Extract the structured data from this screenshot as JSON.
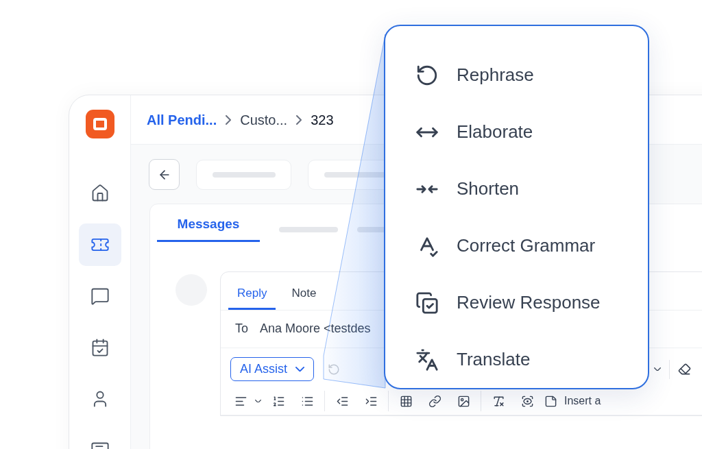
{
  "sidebar": {
    "items": [
      {
        "kind": "home",
        "selected": false
      },
      {
        "kind": "ticket",
        "selected": true
      },
      {
        "kind": "chat",
        "selected": false
      },
      {
        "kind": "calendar",
        "selected": false
      },
      {
        "kind": "user",
        "selected": false
      },
      {
        "kind": "message",
        "selected": false
      }
    ]
  },
  "breadcrumbs": [
    {
      "label": "All Pendi...",
      "kind": "link"
    },
    {
      "label": "Custo...",
      "kind": "crumb"
    },
    {
      "label": "323",
      "kind": "current"
    }
  ],
  "tabs": [
    {
      "label": "Messages",
      "selected": true
    }
  ],
  "composer": {
    "tabs": [
      {
        "label": "Reply",
        "selected": true
      },
      {
        "label": "Note",
        "selected": false
      }
    ],
    "to_label": "To",
    "recipient": "Ana Moore <testdes",
    "ai_assist": "AI Assist",
    "insert_label": "Insert a"
  },
  "menu": {
    "items": [
      {
        "kind": "rephrase",
        "label": "Rephrase"
      },
      {
        "kind": "elaborate",
        "label": "Elaborate"
      },
      {
        "kind": "shorten",
        "label": "Shorten"
      },
      {
        "kind": "grammar",
        "label": "Correct Grammar"
      },
      {
        "kind": "review",
        "label": "Review Response"
      },
      {
        "kind": "translate",
        "label": "Translate"
      }
    ]
  }
}
